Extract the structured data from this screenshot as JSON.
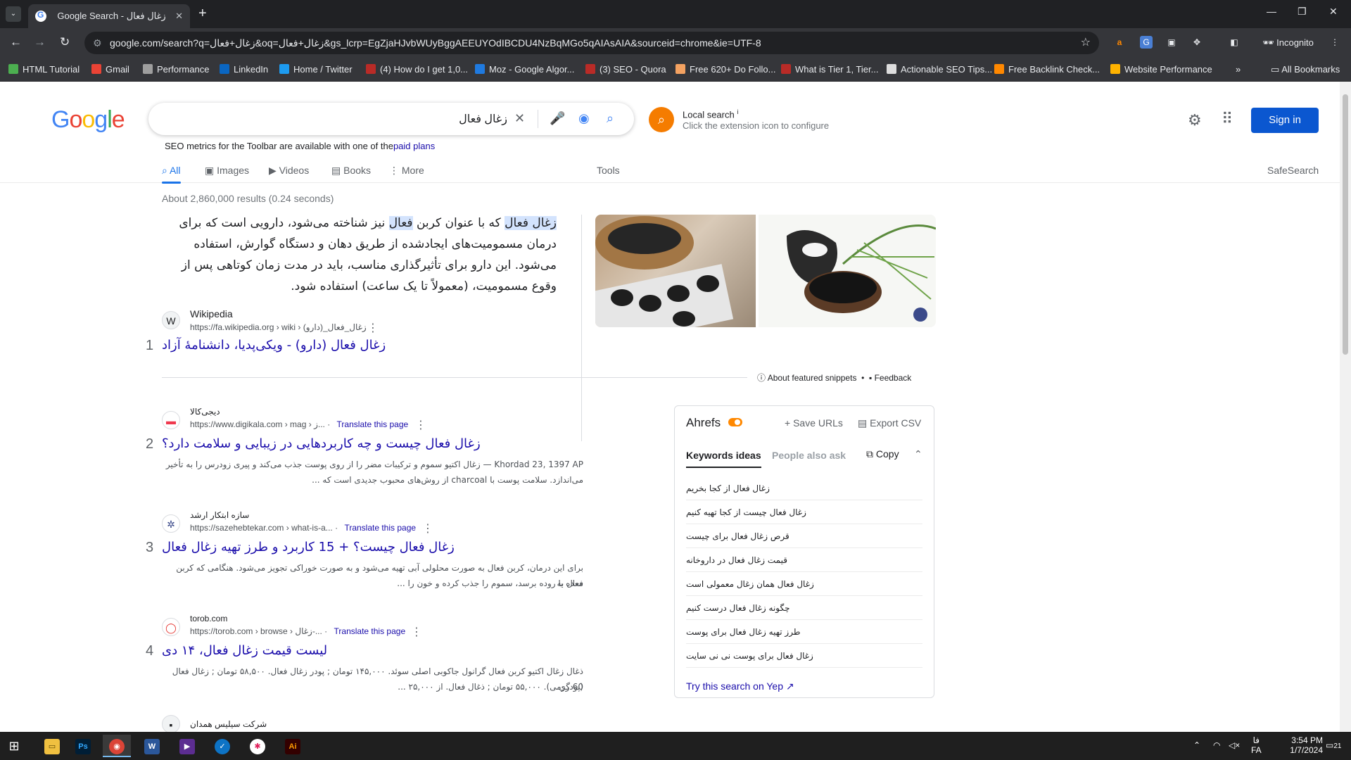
{
  "browser": {
    "tab_title": "Google Search - زغال فعال",
    "url": "google.com/search?q=زغال+فعال&oq=زغال+فعال&gs_lcrp=EgZjaHJvbWUyBggAEEUYOdIBCDU4NzBqMGo5qAIAsAIA&sourceid=chrome&ie=UTF-8",
    "incognito_label": "Incognito",
    "bookmarks": [
      {
        "label": "HTML Tutorial",
        "color": "#4caf50"
      },
      {
        "label": "Gmail",
        "color": "#ea4335"
      },
      {
        "label": "Performance",
        "color": "#9e9e9e"
      },
      {
        "label": "LinkedIn",
        "color": "#0a66c2"
      },
      {
        "label": "Home / Twitter",
        "color": "#1d9bf0"
      },
      {
        "label": "(4) How do I get 1,0...",
        "color": "#b92b27"
      },
      {
        "label": "Moz - Google Algor...",
        "color": "#1f7ae0"
      },
      {
        "label": "(3) SEO - Quora",
        "color": "#b92b27"
      },
      {
        "label": "Free 620+ Do Follo...",
        "color": "#f4a261"
      },
      {
        "label": "What is Tier 1, Tier...",
        "color": "#b92b27"
      },
      {
        "label": "Actionable SEO Tips...",
        "color": "#dddddd"
      },
      {
        "label": "Free Backlink Check...",
        "color": "#ff8800"
      },
      {
        "label": "Website Performance",
        "color": "#ffb300"
      }
    ],
    "all_bookmarks": "All Bookmarks"
  },
  "google": {
    "logo": "Google",
    "query": "زغال فعال",
    "seo_note": "SEO metrics for the Toolbar are available with one of the",
    "seo_note_link": "paid plans",
    "local_search_title": "Local search",
    "local_search_sub": "Click the extension icon to configure",
    "sign_in": "Sign in",
    "tabs": [
      "All",
      "Images",
      "Videos",
      "Books",
      "More"
    ],
    "tools": "Tools",
    "safesearch": "SafeSearch",
    "results_count": "About 2,860,000 results (0.24 seconds)"
  },
  "featured": {
    "highlight": "زغال فعال",
    "text_part1": " که با عنوان کربن ",
    "highlight2": "فعال",
    "text_part2": " نیز شناخته می‌شود، دارویی است که برای درمان مسمومیت‌های ایجادشده از طریق دهان و دستگاه گوارش، استفاده می‌شود. این دارو برای تأثیرگذاری مناسب، باید در مدت زمان کوتاهی پس از وقوع مسمومیت، (معمولاً تا یک ساعت) استفاده شود.",
    "source_name": "Wikipedia",
    "source_url": "https://fa.wikipedia.org › wiki › زغال_فعال_(دارو)",
    "title": "زغال فعال (دارو) - ویکی‌پدیا، دانشنامهٔ آزاد",
    "num": "1",
    "about": "About featured snippets",
    "feedback": "Feedback"
  },
  "results": [
    {
      "num": "2",
      "source_name": "دیجی‌کالا",
      "source_url": "https://www.digikala.com › mag › ز...",
      "translate": "Translate this page",
      "title": "زغال فعال چیست و چه کاربردهایی در زیبایی و سلامت دارد؟",
      "desc1": "Khordad 23, 1397 AP — زغال اکتیو سموم و ترکیبات مضر را از روی پوست جذب می‌کند و پیری زودرس را به تأخیر",
      "desc2": "می‌اندازد. سلامت پوست با charcoal از روش‌های محبوب جدیدی است که ..."
    },
    {
      "num": "3",
      "source_name": "سازه ابتکار ارشد",
      "source_url": "https://sazehebtekar.com › what-is-a...",
      "translate": "Translate this page",
      "title": "زغال فعال چیست؟ + 15 کاربرد و طرز تهیه زغال فعال",
      "desc1": "برای این درمان، کربن فعال به صورت محلولی آبی تهیه می‌شود و به صورت خوراکی تجویز می‌شود. هنگامی که کربن فعال به",
      "desc2": "معده یا روده برسد، سموم را جذب کرده و خون را ..."
    },
    {
      "num": "4",
      "source_name": "torob.com",
      "source_url": "https://torob.com › browse › زغال-...",
      "translate": "Translate this page",
      "title": "لیست قیمت زغال فعال، ۱۴ دی",
      "desc1": "ذغال زغال اکتیو کربن فعال گرانول جاکوبی اصلی سوئد. ۱۴۵,۰۰۰ تومان ; پودر زغال فعال. ۵۸,۵۰۰ تومان ; زغال فعال (پودری",
      "desc2": "60 گرمی). ۵۵,۰۰۰ تومان ; ذغال فعال. از ۲۵,۰۰۰ ..."
    }
  ],
  "partial_result": "شرکت سیلیس همدان",
  "ahrefs": {
    "title": "Ahrefs",
    "save_urls": "Save URLs",
    "export_csv": "Export CSV",
    "tab_keywords": "Keywords ideas",
    "tab_paa": "People also ask",
    "copy": "Copy",
    "keywords": [
      "زغال فعال از کجا بخریم",
      "زغال فعال چیست از کجا تهیه کنیم",
      "قرص زغال فعال برای چیست",
      "قیمت زغال فعال در داروخانه",
      "زغال فعال همان زغال معمولی است",
      "چگونه زغال فعال درست کنیم",
      "طرز تهیه زغال فعال برای پوست",
      "زغال فعال برای پوست نی نی سایت"
    ],
    "yep": "Try this search on Yep"
  },
  "taskbar": {
    "time": "3:54 PM",
    "date": "1/7/2024",
    "lang1": "فا",
    "lang2": "FA",
    "notif": "21"
  }
}
